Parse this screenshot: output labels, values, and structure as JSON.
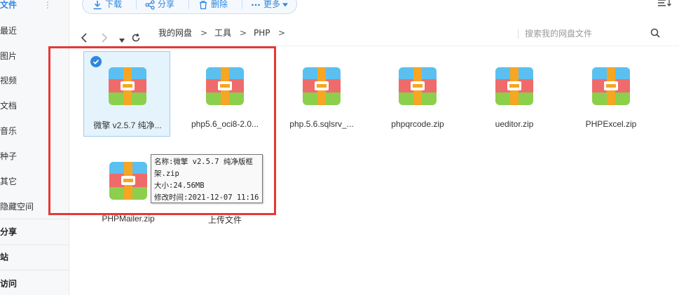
{
  "sidebar": {
    "items": [
      {
        "label": "文件",
        "state": "active"
      },
      {
        "label": "最近"
      },
      {
        "label": "图片"
      },
      {
        "label": "视频"
      },
      {
        "label": "文档"
      },
      {
        "label": "音乐"
      },
      {
        "label": "种子"
      },
      {
        "label": "其它"
      },
      {
        "label": "隐藏空间"
      }
    ],
    "groups": [
      {
        "label": "分享"
      },
      {
        "label": "站"
      },
      {
        "label": "访问"
      }
    ],
    "more_icon": "vertical-dots-icon"
  },
  "toolbar": {
    "download_label": "下载",
    "share_label": "分享",
    "delete_label": "删除",
    "more_label": "更多"
  },
  "nav": {
    "breadcrumbs": [
      "我的网盘",
      "工具",
      "PHP"
    ],
    "separator": ">",
    "search_placeholder": "搜索我的网盘文件"
  },
  "files": [
    {
      "name": "微擎 v2.5.7 纯净...",
      "selected": true
    },
    {
      "name": "php5.6_oci8-2.0..."
    },
    {
      "name": "php.5.6.sqlsrv_..."
    },
    {
      "name": "phpqrcode.zip"
    },
    {
      "name": "ueditor.zip"
    },
    {
      "name": "PHPExcel.zip"
    },
    {
      "name": "PHPMailer.zip"
    }
  ],
  "upload_label": "上传文件",
  "tooltip": {
    "line1": "名称:微擎 v2.5.7 纯净版框",
    "line2": "架.zip",
    "line3": "大小:24.56MB",
    "line4": "修改时间:2021-12-07 11:16"
  },
  "colors": {
    "accent": "#2e86de",
    "annotation_red": "#e53935",
    "zip_blue": "#5bc0f0",
    "zip_red": "#ef6b6b",
    "zip_green": "#8ccf4d",
    "zip_orange": "#f5a623"
  }
}
